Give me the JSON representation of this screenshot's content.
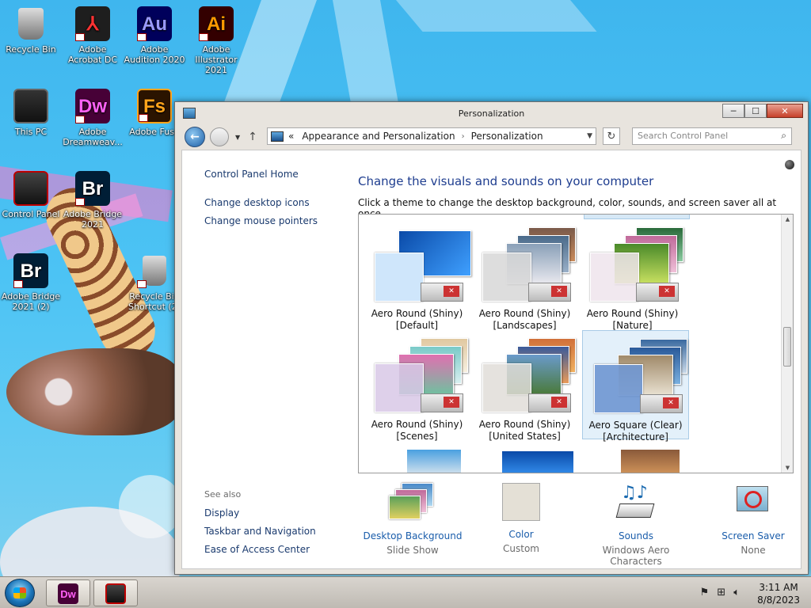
{
  "desktop": {
    "icons": [
      {
        "label": "Recycle Bin",
        "glyph": "",
        "color": "#888888"
      },
      {
        "label": "Adobe Acrobat DC",
        "glyph": "⅄",
        "color": "#1e1e1e"
      },
      {
        "label": "Adobe Audition 2020",
        "glyph": "Au",
        "color": "#00005b"
      },
      {
        "label": "Adobe Illustrator 2021",
        "glyph": "Ai",
        "color": "#330000"
      },
      {
        "label": "This PC",
        "glyph": "",
        "color": "#222222"
      },
      {
        "label": "Adobe Dreamweav...",
        "glyph": "Dw",
        "color": "#470137"
      },
      {
        "label": "Adobe Fuse",
        "glyph": "Fs",
        "color": "#2b1400"
      },
      {
        "label": "Control Panel",
        "glyph": "",
        "color": "#222222"
      },
      {
        "label": "Adobe Bridge 2021",
        "glyph": "Br",
        "color": "#001e36"
      },
      {
        "label": "Adobe Bridge 2021 (2)",
        "glyph": "Br",
        "color": "#001e36"
      },
      {
        "label": "Recycle Bin Shortcut (2)",
        "glyph": "",
        "color": "#888888"
      }
    ]
  },
  "window": {
    "title": "Personalization",
    "buttons": {
      "minimize": "─",
      "maximize": "☐",
      "close": "✕"
    },
    "nav": {
      "breadcrumb_prefix": "«",
      "crumb1": "Appearance and Personalization",
      "crumb_sep": "›",
      "crumb2": "Personalization",
      "search_placeholder": "Search Control Panel"
    },
    "left": {
      "home": "Control Panel Home",
      "link1": "Change desktop icons",
      "link2": "Change mouse pointers",
      "see_also": "See also",
      "sa1": "Display",
      "sa2": "Taskbar and Navigation",
      "sa3": "Ease of Access Center"
    },
    "main": {
      "title": "Change the visuals and sounds on your computer",
      "subtitle": "Click a theme to change the desktop background, color, sounds, and screen saver all at once."
    },
    "themes": [
      {
        "name": "Aero Round (Shiny)",
        "variant": "[Default]",
        "bg": "#1e6fd0",
        "swatch": "#cfe6fb"
      },
      {
        "name": "Aero Round (Shiny)",
        "variant": "[Landscapes]",
        "bg": "#6a7a8a",
        "swatch": "#d7d7d7"
      },
      {
        "name": "Aero Round (Shiny)",
        "variant": "[Nature]",
        "bg": "#4a8a3a",
        "swatch": "#efe4ec"
      },
      {
        "name": "Aero Round (Shiny)",
        "variant": "[Scenes]",
        "bg": "#7aaa9a",
        "swatch": "#d8c8e6"
      },
      {
        "name": "Aero Round (Shiny)",
        "variant": "[United States]",
        "bg": "#c07a3a",
        "swatch": "#e0ddd8"
      },
      {
        "name": "Aero Square (Clear)",
        "variant": "[Architecture]",
        "bg": "#4a7ab0",
        "swatch": "#7aa6dc"
      }
    ],
    "bottom": [
      {
        "label": "Desktop Background",
        "sub": "Slide Show"
      },
      {
        "label": "Color",
        "sub": "Custom"
      },
      {
        "label": "Sounds",
        "sub": "Windows Aero Characters"
      },
      {
        "label": "Screen Saver",
        "sub": "None"
      }
    ]
  },
  "taskbar": {
    "apps": [
      {
        "name": "Dw"
      },
      {
        "name": "Control Panel"
      }
    ],
    "time": "3:11 AM",
    "date": "8/8/2023"
  }
}
